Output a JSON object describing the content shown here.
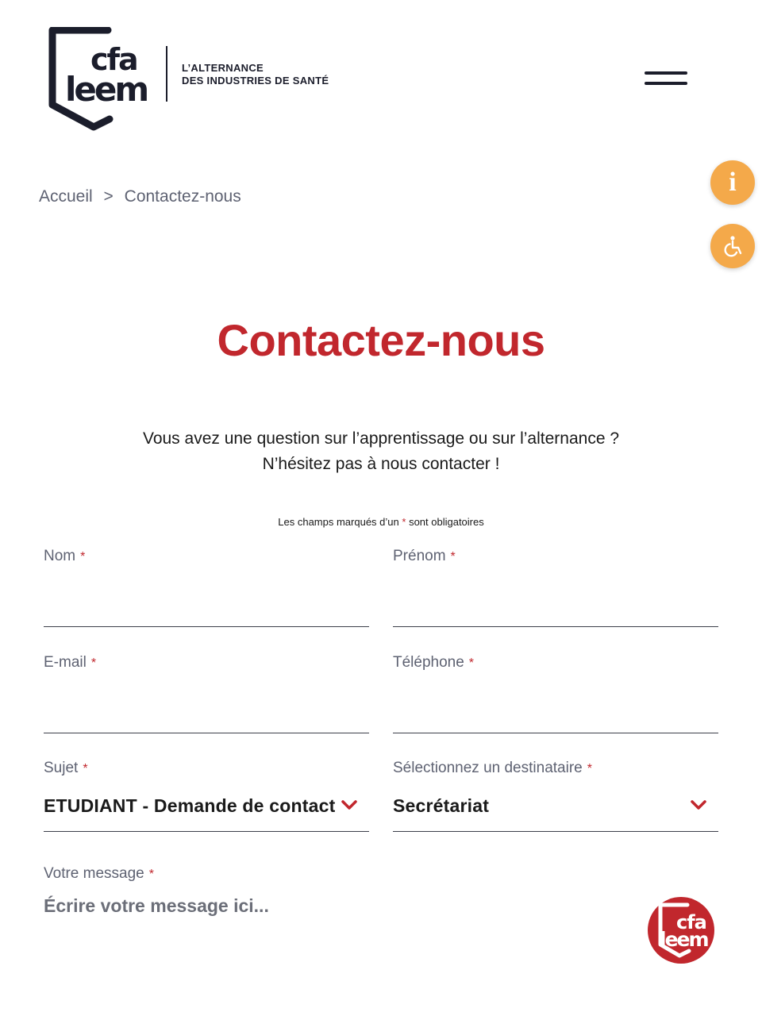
{
  "header": {
    "logo_text_top": "cfa",
    "logo_text_bottom": "leem",
    "tagline_line1": "L’ALTERNANCE",
    "tagline_line2": "DES INDUSTRIES DE SANTÉ",
    "menu_icon": "hamburger-icon"
  },
  "floating": {
    "info_glyph": "i",
    "info_icon": "info-icon",
    "accessibility_icon": "wheelchair-icon",
    "color": "#f4a94a"
  },
  "breadcrumb": {
    "home": "Accueil",
    "separator": ">",
    "current": "Contactez-nous"
  },
  "page": {
    "title": "Contactez-nous",
    "intro_line1": "Vous avez une question sur l’apprentissage ou sur l’alternance ?",
    "intro_line2": "N’hésitez pas à nous contacter !",
    "required_before": "Les champs marqués d’un",
    "required_star": "*",
    "required_after": "sont obligatoires",
    "accent_color": "#c1272d"
  },
  "form": {
    "nom": {
      "label": "Nom",
      "required": "*",
      "value": ""
    },
    "prenom": {
      "label": "Prénom",
      "required": "*",
      "value": ""
    },
    "email": {
      "label": "E-mail",
      "required": "*",
      "value": ""
    },
    "telephone": {
      "label": "Téléphone",
      "required": "*",
      "value": ""
    },
    "sujet": {
      "label": "Sujet",
      "required": "*",
      "selected": "ETUDIANT - Demande de contact"
    },
    "destinataire": {
      "label": "Sélectionnez un destinataire",
      "required": "*",
      "selected": "Secrétariat"
    },
    "message": {
      "label": "Votre message",
      "required": "*",
      "placeholder": "Écrire votre message ici..."
    }
  },
  "chat": {
    "icon": "chat-bot-logo-icon",
    "text_top": "cfa",
    "text_bottom": "leem"
  }
}
